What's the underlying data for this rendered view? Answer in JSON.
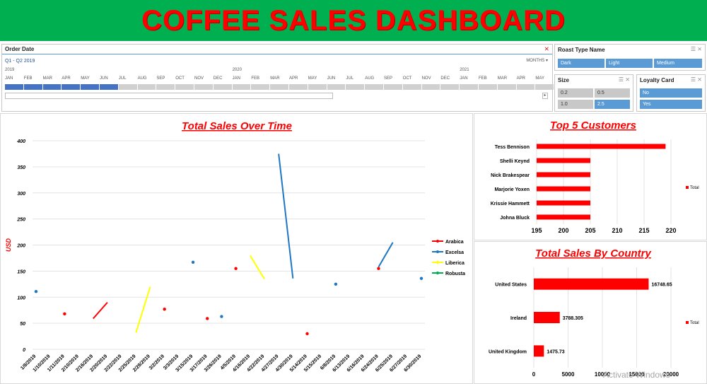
{
  "banner": {
    "title": "COFFEE SALES DASHBOARD"
  },
  "timeline": {
    "title": "Order Date",
    "range_label": "Q1 - Q2 2019",
    "level_label": "MONTHS ▾",
    "years": [
      "2019",
      "2020",
      "2021"
    ],
    "months": [
      "JAN",
      "FEB",
      "MAR",
      "APR",
      "MAY",
      "JUN",
      "JUL",
      "AUG",
      "SEP",
      "OCT",
      "NOV",
      "DEC",
      "JAN",
      "FEB",
      "MAR",
      "APR",
      "MAY",
      "JUN",
      "JUL",
      "AUG",
      "SEP",
      "OCT",
      "NOV",
      "DEC",
      "JAN",
      "FEB",
      "MAR",
      "APR",
      "MAY"
    ],
    "selected_months": 6
  },
  "roast_slicer": {
    "title": "Roast Type Name",
    "items": [
      {
        "label": "Dark",
        "selected": true
      },
      {
        "label": "Light",
        "selected": true
      },
      {
        "label": "Medium",
        "selected": true
      }
    ]
  },
  "size_slicer": {
    "title": "Size",
    "items": [
      {
        "label": "0.2",
        "selected": false
      },
      {
        "label": "0.5",
        "selected": false
      },
      {
        "label": "1.0",
        "selected": false
      },
      {
        "label": "2.5",
        "selected": true
      }
    ]
  },
  "loyalty_slicer": {
    "title": "Loyalty Card",
    "items": [
      {
        "label": "No",
        "selected": true
      },
      {
        "label": "Yes",
        "selected": true
      }
    ]
  },
  "watermark": "Activate Windows",
  "colors": {
    "banner": "#00b050",
    "title_red": "#ff0000",
    "arabica": "#ff0000",
    "excelsa": "#1f77c4",
    "liberica": "#ffff00",
    "robusta": "#00b050",
    "bar": "#ff0000",
    "selected": "#5b9bd5"
  },
  "chart_data": [
    {
      "type": "line",
      "title": "Total Sales Over Time",
      "ylabel": "USD",
      "xlabel": "",
      "ylim": [
        0,
        400
      ],
      "yticks": [
        0,
        50,
        100,
        150,
        200,
        250,
        300,
        350,
        400
      ],
      "grid": true,
      "legend_position": "right",
      "categories": [
        "1/8/2019",
        "1/10/2019",
        "1/11/2019",
        "2/10/2019",
        "2/16/2019",
        "2/20/2019",
        "2/22/2019",
        "2/25/2019",
        "2/28/2019",
        "3/2/2019",
        "3/3/2019",
        "3/15/2019",
        "3/17/2019",
        "3/26/2019",
        "4/5/2019",
        "4/16/2019",
        "4/22/2019",
        "4/27/2019",
        "4/30/2019",
        "5/14/2019",
        "5/15/2019",
        "6/8/2019",
        "6/13/2019",
        "6/16/2019",
        "6/24/2019",
        "6/25/2019",
        "6/27/2019",
        "6/30/2019"
      ],
      "series": [
        {
          "name": "Arabica",
          "values": [
            null,
            null,
            68,
            null,
            59,
            90,
            null,
            null,
            null,
            77,
            null,
            null,
            59,
            null,
            155,
            null,
            null,
            null,
            null,
            30,
            null,
            null,
            null,
            null,
            155,
            null,
            null,
            null
          ]
        },
        {
          "name": "Excelsa",
          "values": [
            111,
            null,
            null,
            null,
            null,
            null,
            null,
            null,
            null,
            null,
            null,
            167,
            null,
            63,
            null,
            null,
            null,
            375,
            136,
            null,
            null,
            125,
            null,
            null,
            158,
            205,
            null,
            136
          ]
        },
        {
          "name": "Liberica",
          "values": [
            null,
            null,
            null,
            null,
            null,
            null,
            null,
            32,
            120,
            null,
            null,
            null,
            null,
            null,
            null,
            180,
            135,
            null,
            null,
            null,
            null,
            null,
            null,
            null,
            null,
            null,
            null,
            null
          ]
        },
        {
          "name": "Robusta",
          "values": [
            null,
            null,
            null,
            null,
            null,
            null,
            null,
            null,
            null,
            null,
            null,
            null,
            null,
            null,
            null,
            null,
            null,
            null,
            null,
            null,
            null,
            null,
            null,
            null,
            null,
            null,
            null,
            null
          ]
        }
      ]
    },
    {
      "type": "bar",
      "orientation": "horizontal",
      "title": "Top 5 Customers",
      "categories": [
        "Tess Bennison",
        "Shelli Keynd",
        "Nick Brakespear",
        "Marjorie Yoxen",
        "Krissie Hammett",
        "Johna Bluck"
      ],
      "values": [
        219,
        205,
        205,
        205,
        205,
        205
      ],
      "xlim": [
        195,
        220
      ],
      "xticks": [
        195,
        200,
        205,
        210,
        215,
        220
      ],
      "series_name": "Total",
      "legend_position": "right",
      "grid": true
    },
    {
      "type": "bar",
      "orientation": "horizontal",
      "title": "Total Sales By Country",
      "categories": [
        "United States",
        "Ireland",
        "United Kingdom"
      ],
      "values": [
        16748.65,
        3788.305,
        1475.73
      ],
      "data_labels": [
        "16748.65",
        "3788.305",
        "1475.73"
      ],
      "xlim": [
        0,
        20000
      ],
      "xticks": [
        0,
        5000,
        10000,
        15000,
        20000
      ],
      "series_name": "Total",
      "legend_position": "right",
      "grid": true
    }
  ]
}
